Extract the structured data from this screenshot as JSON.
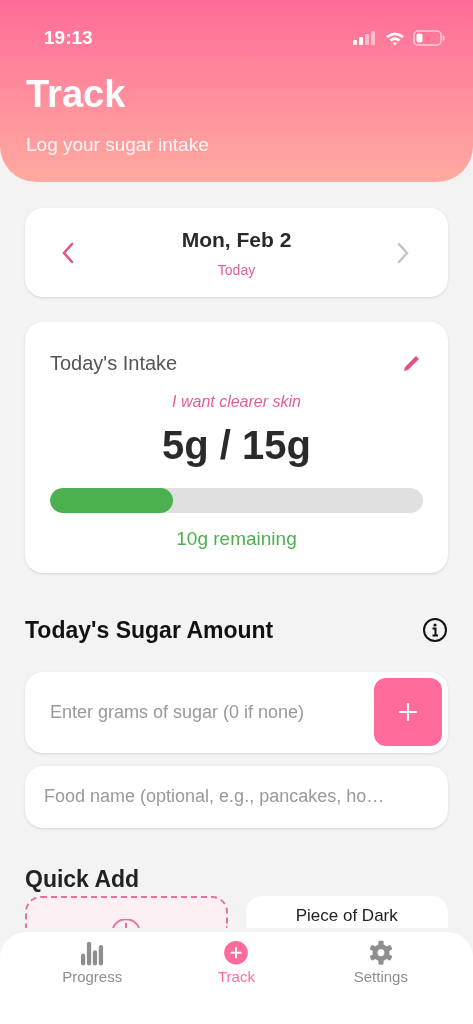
{
  "status_bar": {
    "time": "19:13"
  },
  "header": {
    "title": "Track",
    "subtitle": "Log your sugar intake"
  },
  "date_nav": {
    "date": "Mon, Feb 2",
    "relative": "Today",
    "next_disabled": true
  },
  "intake": {
    "title": "Today's Intake",
    "goal_note": "I want clearer skin",
    "amount": "5g / 15g",
    "level": 0.33,
    "remaining": "10g remaining"
  },
  "sugar_entry": {
    "title": "Today's Sugar Amount",
    "grams_placeholder": "Enter grams of sugar (0 if none)",
    "food_placeholder": "Food name (optional, e.g., pancakes, ho…"
  },
  "quick_add": {
    "title": "Quick Add",
    "items": [
      {
        "kind": "custom"
      },
      {
        "kind": "food",
        "label": "Piece of Dark"
      }
    ]
  },
  "tabs": [
    {
      "label": "Progress",
      "selected": false
    },
    {
      "label": "Track",
      "selected": true
    },
    {
      "label": "Settings",
      "selected": false
    }
  ]
}
